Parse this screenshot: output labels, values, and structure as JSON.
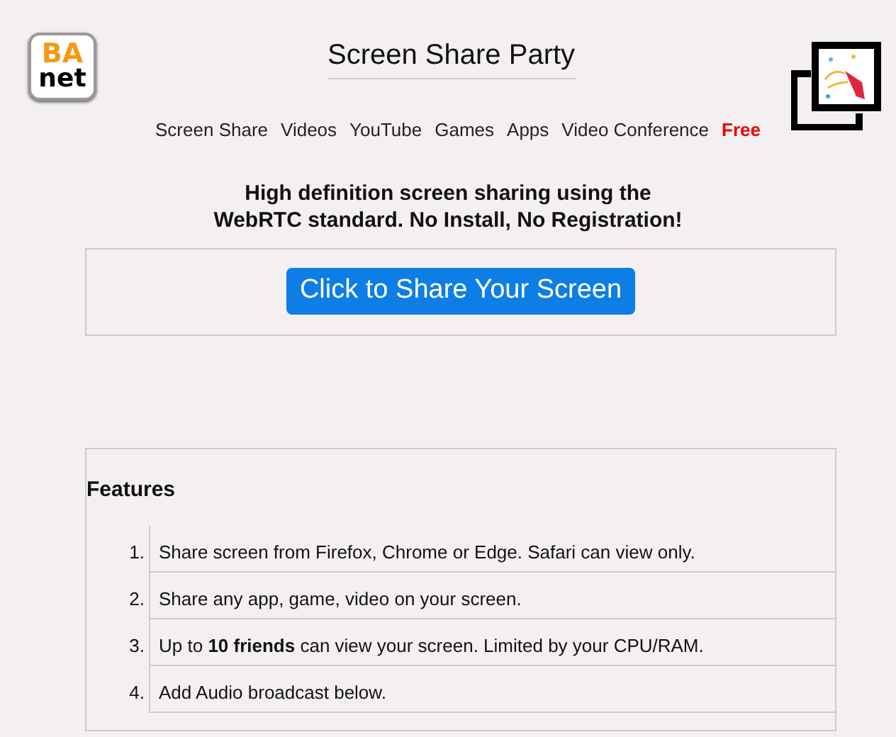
{
  "logo": {
    "line_1": "BA",
    "line_2": "net"
  },
  "title": "Screen Share Party",
  "nav": [
    {
      "label": "Screen Share",
      "highlight": false
    },
    {
      "label": "Videos",
      "highlight": false
    },
    {
      "label": "YouTube",
      "highlight": false
    },
    {
      "label": "Games",
      "highlight": false
    },
    {
      "label": "Apps",
      "highlight": false
    },
    {
      "label": "Video Conference",
      "highlight": false
    },
    {
      "label": "Free",
      "highlight": true
    }
  ],
  "headline": [
    "High definition screen sharing using the",
    "WebRTC standard. No Install, No Registration!"
  ],
  "share_button": "Click to Share Your Screen",
  "features": {
    "title": "Features",
    "items": [
      {
        "number": "1.",
        "text": "Share screen from Firefox, Chrome or Edge. Safari can view only."
      },
      {
        "number": "2.",
        "text": "Share any app, game, video on your screen."
      },
      {
        "number": "3.",
        "text": "Up to **10 friends** can view your screen. Limited by your CPU/RAM."
      },
      {
        "number": "4.",
        "text": "Add Audio broadcast below."
      }
    ]
  }
}
